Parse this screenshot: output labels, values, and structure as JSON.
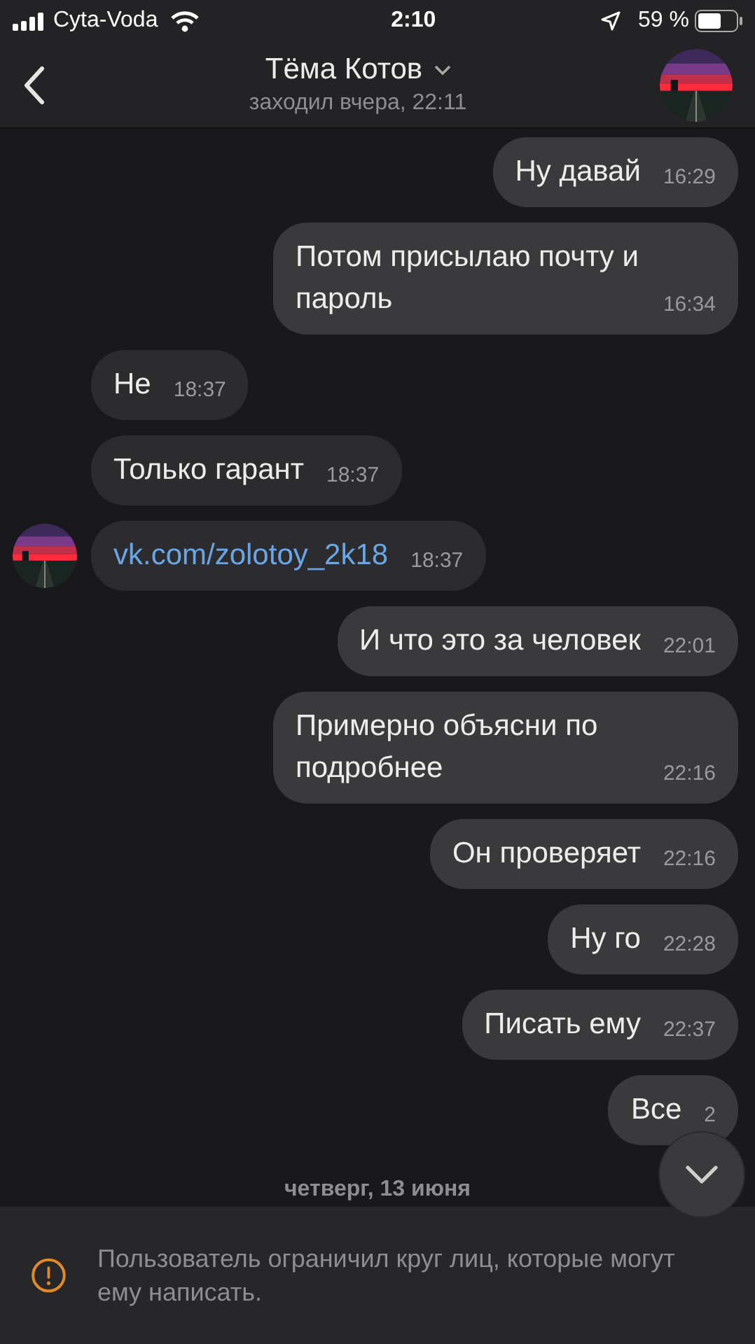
{
  "status_bar": {
    "carrier": "Cyta-Voda",
    "time": "2:10",
    "battery": "59 %"
  },
  "header": {
    "name": "Тёма Котов",
    "last_seen": "заходил вчера, 22:11"
  },
  "messages": [
    {
      "kind": "outgoing",
      "text": "Ну давай",
      "time": "16:29"
    },
    {
      "kind": "outgoing",
      "text": "Потом присылаю почту и пароль",
      "time": "16:34"
    },
    {
      "kind": "incoming",
      "text": "Не",
      "time": "18:37",
      "avatar": false
    },
    {
      "kind": "incoming",
      "text": "Только гарант",
      "time": "18:37",
      "avatar": false
    },
    {
      "kind": "incoming_link",
      "text": "vk.com/zolotoy_2k18",
      "time": "18:37",
      "avatar": true
    },
    {
      "kind": "outgoing",
      "text": "И что это за человек",
      "time": "22:01"
    },
    {
      "kind": "outgoing",
      "text": "Примерно объясни по подробнее",
      "time": "22:16"
    },
    {
      "kind": "outgoing",
      "text": "Он проверяет",
      "time": "22:16"
    },
    {
      "kind": "outgoing",
      "text": "Ну го",
      "time": "22:28"
    },
    {
      "kind": "outgoing",
      "text": "Писать ему",
      "time": "22:37"
    },
    {
      "kind": "outgoing",
      "text": "Все",
      "time": "2"
    }
  ],
  "date_separator": "четверг, 13 июня",
  "notice": "Пользователь ограничил круг лиц, которые могут ему написать."
}
